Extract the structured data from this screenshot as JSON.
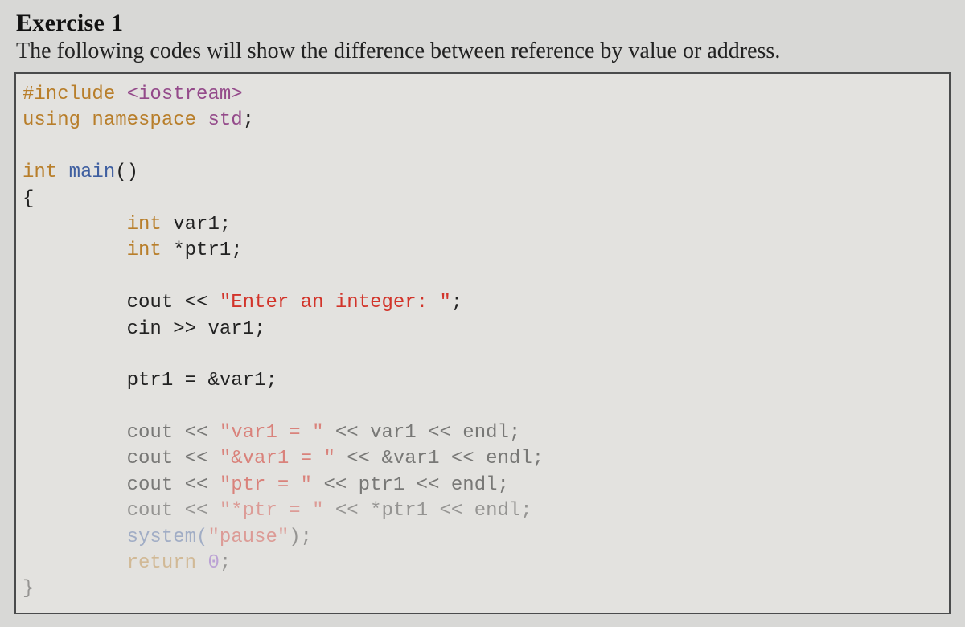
{
  "heading": "Exercise 1",
  "intro": "The following codes will show the difference between reference by value or address.",
  "code": {
    "l1_pre": "#include",
    "l1_hdr": " <iostream>",
    "l2_kw": "using",
    "l2_ns": " namespace",
    "l2_std": " std",
    "l2_end": ";",
    "l4_int": "int",
    "l4_main": " main",
    "l4_paren": "()",
    "l5_brace": "{",
    "l6_int": "int",
    "l6_var": " var1;",
    "l7_int": "int",
    "l7_ptr": " *ptr1;",
    "l9a": "cout << ",
    "l9s": "\"Enter an integer: \"",
    "l9b": ";",
    "l10a": "cin >> var1;",
    "l12a": "ptr1 = &var1;",
    "l14a": "cout << ",
    "l14s": "\"var1 = \"",
    "l14b": " << var1 << endl;",
    "l15a": "cout << ",
    "l15s": "\"&var1 = \"",
    "l15b": " << &var1 << endl;",
    "l16a": "cout << ",
    "l16s": "\"ptr = \"",
    "l16b": " << ptr1 << endl;",
    "l17a": "cout << ",
    "l17s": "\"*ptr = \"",
    "l17b": " << *ptr1 << endl;",
    "l18a": "system(",
    "l18s": "\"pause\"",
    "l18b": ");",
    "l19_kw": "return",
    "l19_num": " 0",
    "l19_end": ";",
    "l20_brace": "}"
  }
}
